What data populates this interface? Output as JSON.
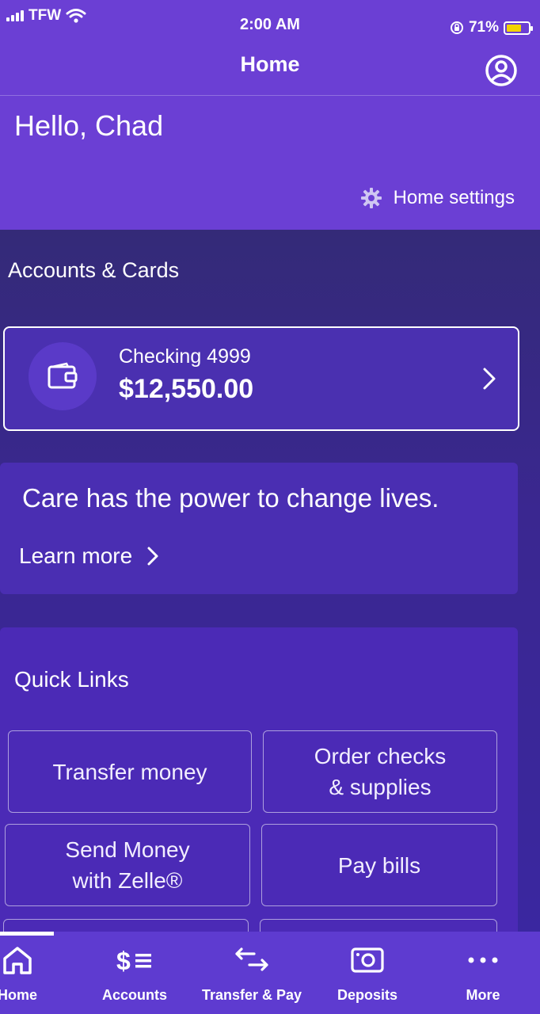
{
  "status_bar": {
    "carrier": "TFW",
    "time": "2:00 AM",
    "battery_percent": "71%",
    "battery_level": 0.71,
    "battery_color": "#f3d300"
  },
  "header": {
    "title": "Home",
    "profile_icon": "account-circle-icon",
    "greeting": "Hello, Chad",
    "settings_label": "Home settings",
    "settings_icon": "gear-icon"
  },
  "accounts": {
    "section_title": "Accounts & Cards",
    "items": [
      {
        "name": "Checking 4999",
        "balance": "$12,550.00",
        "icon": "wallet-icon"
      }
    ]
  },
  "promo": {
    "text": "Care has the power to change lives.",
    "link_label": "Learn more"
  },
  "quick_links": {
    "title": "Quick Links",
    "items": [
      {
        "line1": "Transfer money",
        "line2": ""
      },
      {
        "line1": "Order checks",
        "line2": "& supplies"
      },
      {
        "line1": "Send Money",
        "line2": "with Zelle®"
      },
      {
        "line1": "Pay bills",
        "line2": ""
      }
    ]
  },
  "tab_bar": {
    "active": "Home",
    "items": [
      {
        "label": "Home",
        "icon": "home-icon"
      },
      {
        "label": "Accounts",
        "icon": "accounts-icon"
      },
      {
        "label": "Transfer & Pay",
        "icon": "transfer-arrows-icon"
      },
      {
        "label": "Deposits",
        "icon": "camera-deposit-icon"
      },
      {
        "label": "More",
        "icon": "more-dots-icon"
      }
    ]
  },
  "colors": {
    "header_bg": "#6b3fd4",
    "content_bg": "#3a2790",
    "card_bg": "#4a30b0",
    "tab_bar_bg": "#5e3bd0"
  }
}
